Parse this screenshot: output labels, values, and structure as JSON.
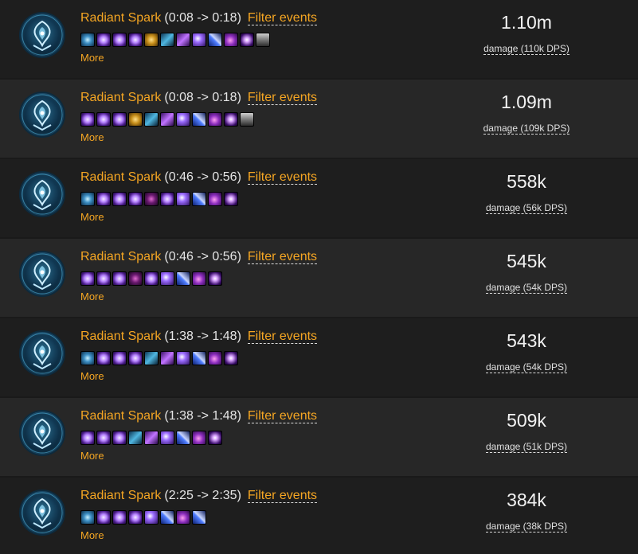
{
  "rows": [
    {
      "spell_name": "Radiant Spark",
      "window": "(0:08 -> 0:18)",
      "filter_label": "Filter events",
      "more_label": "More",
      "amount": "1.10m",
      "dps_label": "damage (110k DPS)",
      "abilities": [
        "spark-icon",
        "arcane-icon",
        "arcane-icon",
        "arcane-icon",
        "gold-icon",
        "blue-icon",
        "feather-icon",
        "barrage-icon",
        "bolt-icon",
        "orb-icon",
        "burst-icon",
        "helm-icon"
      ]
    },
    {
      "spell_name": "Radiant Spark",
      "window": "(0:08 -> 0:18)",
      "filter_label": "Filter events",
      "more_label": "More",
      "amount": "1.09m",
      "dps_label": "damage (109k DPS)",
      "abilities": [
        "arcane-icon",
        "arcane-icon",
        "arcane-icon",
        "gold-icon",
        "blue-icon",
        "feather-icon",
        "barrage-icon",
        "bolt-icon",
        "orb-icon",
        "burst-icon",
        "helm-icon"
      ]
    },
    {
      "spell_name": "Radiant Spark",
      "window": "(0:46 -> 0:56)",
      "filter_label": "Filter events",
      "more_label": "More",
      "amount": "558k",
      "dps_label": "damage (56k DPS)",
      "abilities": [
        "spark-icon",
        "arcane-icon",
        "arcane-icon",
        "arcane-icon",
        "dark-icon",
        "arcane-icon",
        "barrage-icon",
        "bolt-icon",
        "orb-icon",
        "burst-icon"
      ]
    },
    {
      "spell_name": "Radiant Spark",
      "window": "(0:46 -> 0:56)",
      "filter_label": "Filter events",
      "more_label": "More",
      "amount": "545k",
      "dps_label": "damage (54k DPS)",
      "abilities": [
        "arcane-icon",
        "arcane-icon",
        "arcane-icon",
        "dark-icon",
        "arcane-icon",
        "barrage-icon",
        "bolt-icon",
        "orb-icon",
        "burst-icon"
      ]
    },
    {
      "spell_name": "Radiant Spark",
      "window": "(1:38 -> 1:48)",
      "filter_label": "Filter events",
      "more_label": "More",
      "amount": "543k",
      "dps_label": "damage (54k DPS)",
      "abilities": [
        "spark-icon",
        "arcane-icon",
        "arcane-icon",
        "arcane-icon",
        "blue-icon",
        "feather-icon",
        "barrage-icon",
        "bolt-icon",
        "orb-icon",
        "burst-icon"
      ]
    },
    {
      "spell_name": "Radiant Spark",
      "window": "(1:38 -> 1:48)",
      "filter_label": "Filter events",
      "more_label": "More",
      "amount": "509k",
      "dps_label": "damage (51k DPS)",
      "abilities": [
        "arcane-icon",
        "arcane-icon",
        "arcane-icon",
        "blue-icon",
        "feather-icon",
        "barrage-icon",
        "bolt-icon",
        "orb-icon",
        "burst-icon"
      ]
    },
    {
      "spell_name": "Radiant Spark",
      "window": "(2:25 -> 2:35)",
      "filter_label": "Filter events",
      "more_label": "More",
      "amount": "384k",
      "dps_label": "damage (38k DPS)",
      "abilities": [
        "spark-icon",
        "arcane-icon",
        "arcane-icon",
        "arcane-icon",
        "barrage-icon",
        "bolt-icon",
        "orb-icon",
        "bolt-icon"
      ]
    }
  ],
  "colors": {
    "accent": "#f5a623",
    "text": "#e6e6e6",
    "row_odd": "#1e1e1e",
    "row_even": "#272727"
  }
}
